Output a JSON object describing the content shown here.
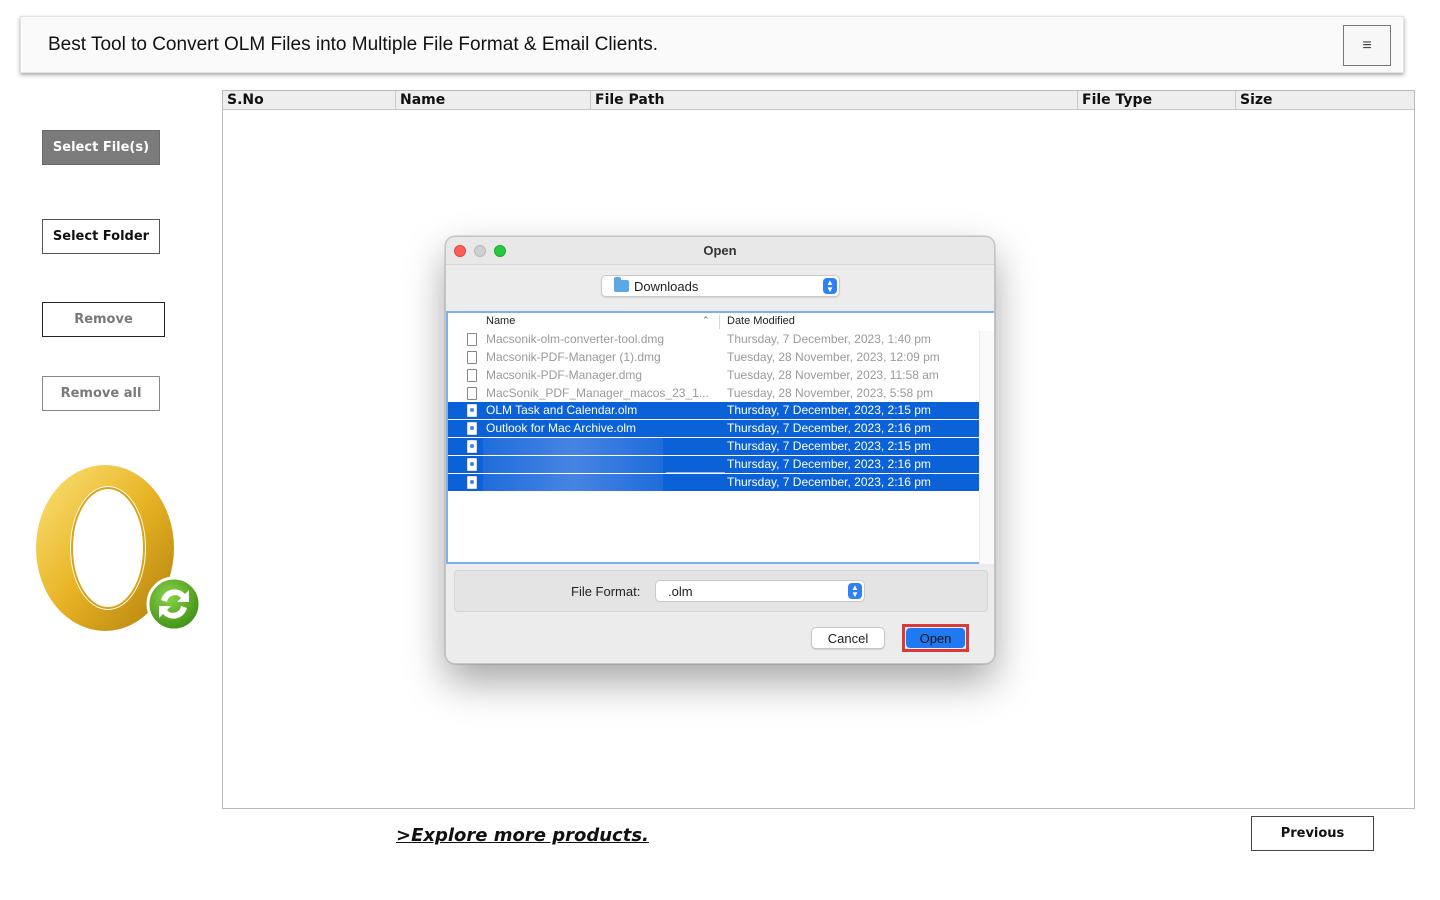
{
  "header": {
    "title": "Best Tool to Convert OLM Files into Multiple File Format & Email Clients.",
    "menu_icon": "≡"
  },
  "left_panel": {
    "select_files": "Select File(s)",
    "select_folder": "Select Folder",
    "remove": "Remove",
    "remove_all": "Remove all",
    "logo_icon": "outlook-mac-converter-logo"
  },
  "table": {
    "columns": [
      "S.No",
      "Name",
      "File Path",
      "File Type",
      "Size"
    ]
  },
  "footer": {
    "explore": ">Explore more products.",
    "previous": "Previous"
  },
  "dialog": {
    "title": "Open",
    "location": "Downloads",
    "columns": {
      "name": "Name",
      "date": "Date Modified"
    },
    "files": [
      {
        "name": "Macsonik-olm-converter-tool.dmg",
        "date": "Thursday, 7 December, 2023, 1:40 pm",
        "state": "dim"
      },
      {
        "name": "Macsonik-PDF-Manager (1).dmg",
        "date": "Tuesday, 28 November, 2023, 12:09 pm",
        "state": "dim"
      },
      {
        "name": "Macsonik-PDF-Manager.dmg",
        "date": "Tuesday, 28 November, 2023, 11:58 am",
        "state": "dim"
      },
      {
        "name": "MacSonik_PDF_Manager_macos_23_1...",
        "date": "Tuesday, 28 November, 2023, 5:58 pm",
        "state": "dim"
      },
      {
        "name": "OLM Task and Calendar.olm",
        "date": "Thursday, 7 December, 2023, 2:15 pm",
        "state": "selected"
      },
      {
        "name": "Outlook for Mac Archive.olm",
        "date": "Thursday, 7 December, 2023, 2:16 pm",
        "state": "selected"
      },
      {
        "name": "",
        "date": "Thursday, 7 December, 2023, 2:15 pm",
        "state": "selected-blurred"
      },
      {
        "name": "",
        "date": "Thursday, 7 December, 2023, 2:16 pm",
        "state": "selected-blurred"
      },
      {
        "name": "",
        "date": "Thursday, 7 December, 2023, 2:16 pm",
        "state": "selected-blurred"
      }
    ],
    "format_label": "File Format:",
    "format_value": ".olm",
    "cancel": "Cancel",
    "open": "Open"
  }
}
